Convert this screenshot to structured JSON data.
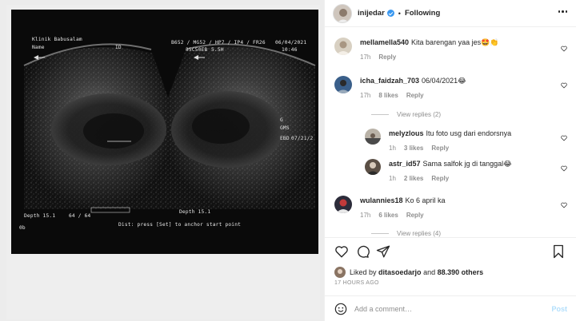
{
  "post": {
    "username": "inijedar",
    "follow_state": "Following",
    "liked_by_user": "ditasoedarjo",
    "liked_by_others": "88.390 others",
    "liked_prefix": "Liked by",
    "liked_and": "and",
    "time_ago": "17 HOURS AGO"
  },
  "photo": {
    "clinic": "Klinik Babusalam",
    "name_label": "Name",
    "id_label": "ID",
    "params_line1": "B652 / MG52 / HP7 / IP4 / FR26",
    "date": "06/04/2021",
    "probe": "35C50EB",
    "depth_cm": "5.5H",
    "time": "10:46",
    "depth_left": "Depth 15.1",
    "gain_left": "64 / 64",
    "depth_right": "Depth 15.1",
    "hint": "Dist: press [Set] to anchor start point",
    "orient": "0b",
    "side_labels": [
      "G",
      "GMS",
      "EBD",
      "07/21/2"
    ]
  },
  "comments": [
    {
      "user": "mellamella540",
      "text": "Kita barengan yaa jes🤩👏",
      "time": "17h",
      "likes": "",
      "reply": "Reply"
    },
    {
      "user": "icha_faidzah_703",
      "text": "06/04/2021😂",
      "time": "17h",
      "likes": "8 likes",
      "reply": "Reply",
      "view_replies": "View replies (2)"
    },
    {
      "user": "melyzlous",
      "text": "Itu foto usg dari endorsnya",
      "time": "1h",
      "likes": "3 likes",
      "reply": "Reply"
    },
    {
      "user": "astr_id57",
      "text": "Sama salfok jg di tanggal😂",
      "time": "1h",
      "likes": "2 likes",
      "reply": "Reply"
    },
    {
      "user": "wulannies18",
      "text": "Ko 6 april ka",
      "time": "17h",
      "likes": "6 likes",
      "reply": "Reply",
      "view_replies": "View replies (4)"
    }
  ],
  "add_comment": {
    "placeholder": "Add a comment…",
    "post_label": "Post"
  },
  "icons": [
    "more-icon",
    "heart-icon",
    "comment-icon",
    "share-icon",
    "bookmark-icon",
    "emoji-icon",
    "verified-badge-icon"
  ],
  "colors": {
    "verified": "#3897f0",
    "post_disabled": "#b2dffc",
    "meta_text": "#8e8e8e",
    "border": "#efefef"
  }
}
